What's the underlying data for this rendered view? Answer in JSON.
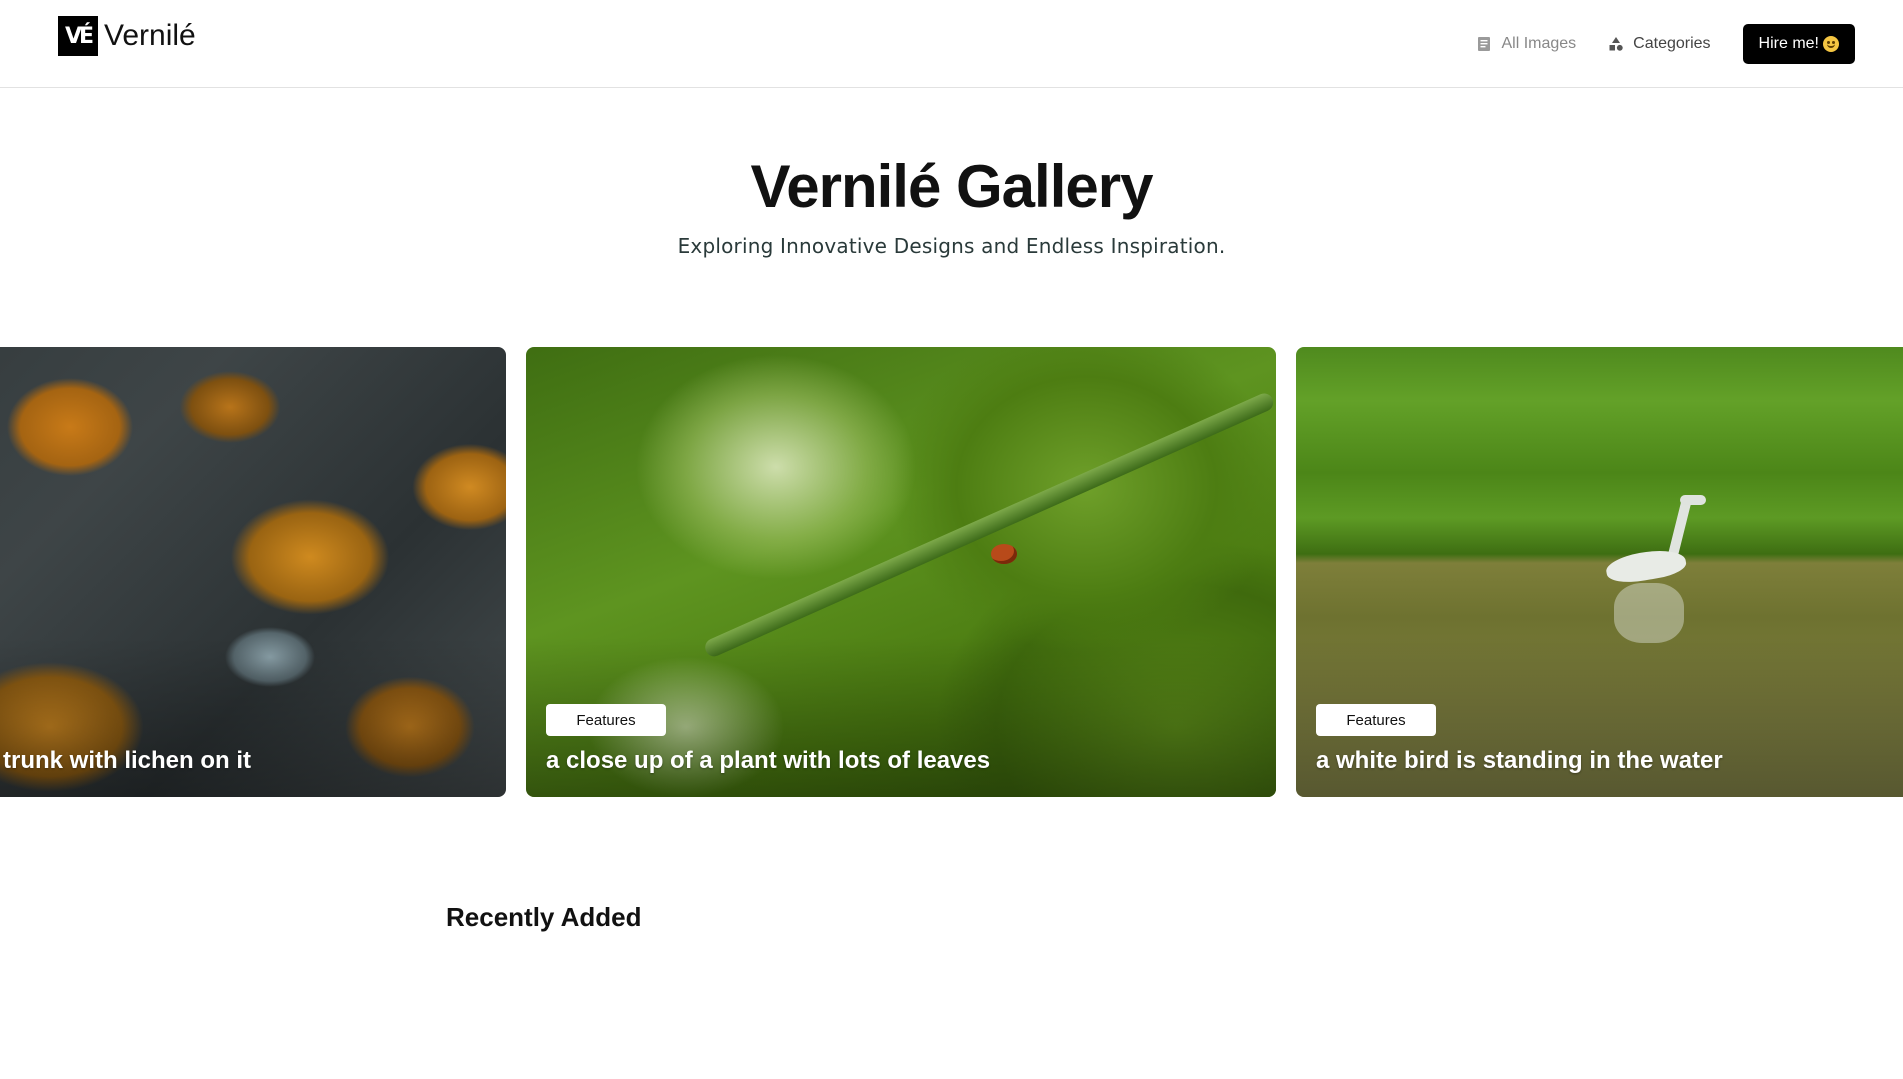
{
  "header": {
    "logo_mark": "VÉ",
    "logo_text": "Vernilé",
    "nav": {
      "all_images": "All Images",
      "categories": "Categories",
      "hire_me": "Hire me!"
    },
    "icons": {
      "all_images": "document-icon",
      "categories": "shapes-icon",
      "hire_me": "smiley-emoji-icon"
    }
  },
  "hero": {
    "title": "Vernilé Gallery",
    "subtitle": "Exploring Innovative Designs and Endless Inspiration."
  },
  "carousel": {
    "cards": [
      {
        "caption": "trunk with lichen on it",
        "badge": ""
      },
      {
        "caption": "a close up of a plant with lots of leaves",
        "badge": "Features"
      },
      {
        "caption": "a white bird is standing in the water",
        "badge": "Features"
      }
    ]
  },
  "sections": {
    "recently_added": "Recently Added"
  },
  "colors": {
    "primary": "#000000",
    "background": "#ffffff",
    "nav_text": "#888888",
    "subtitle": "#2a3a3a"
  }
}
